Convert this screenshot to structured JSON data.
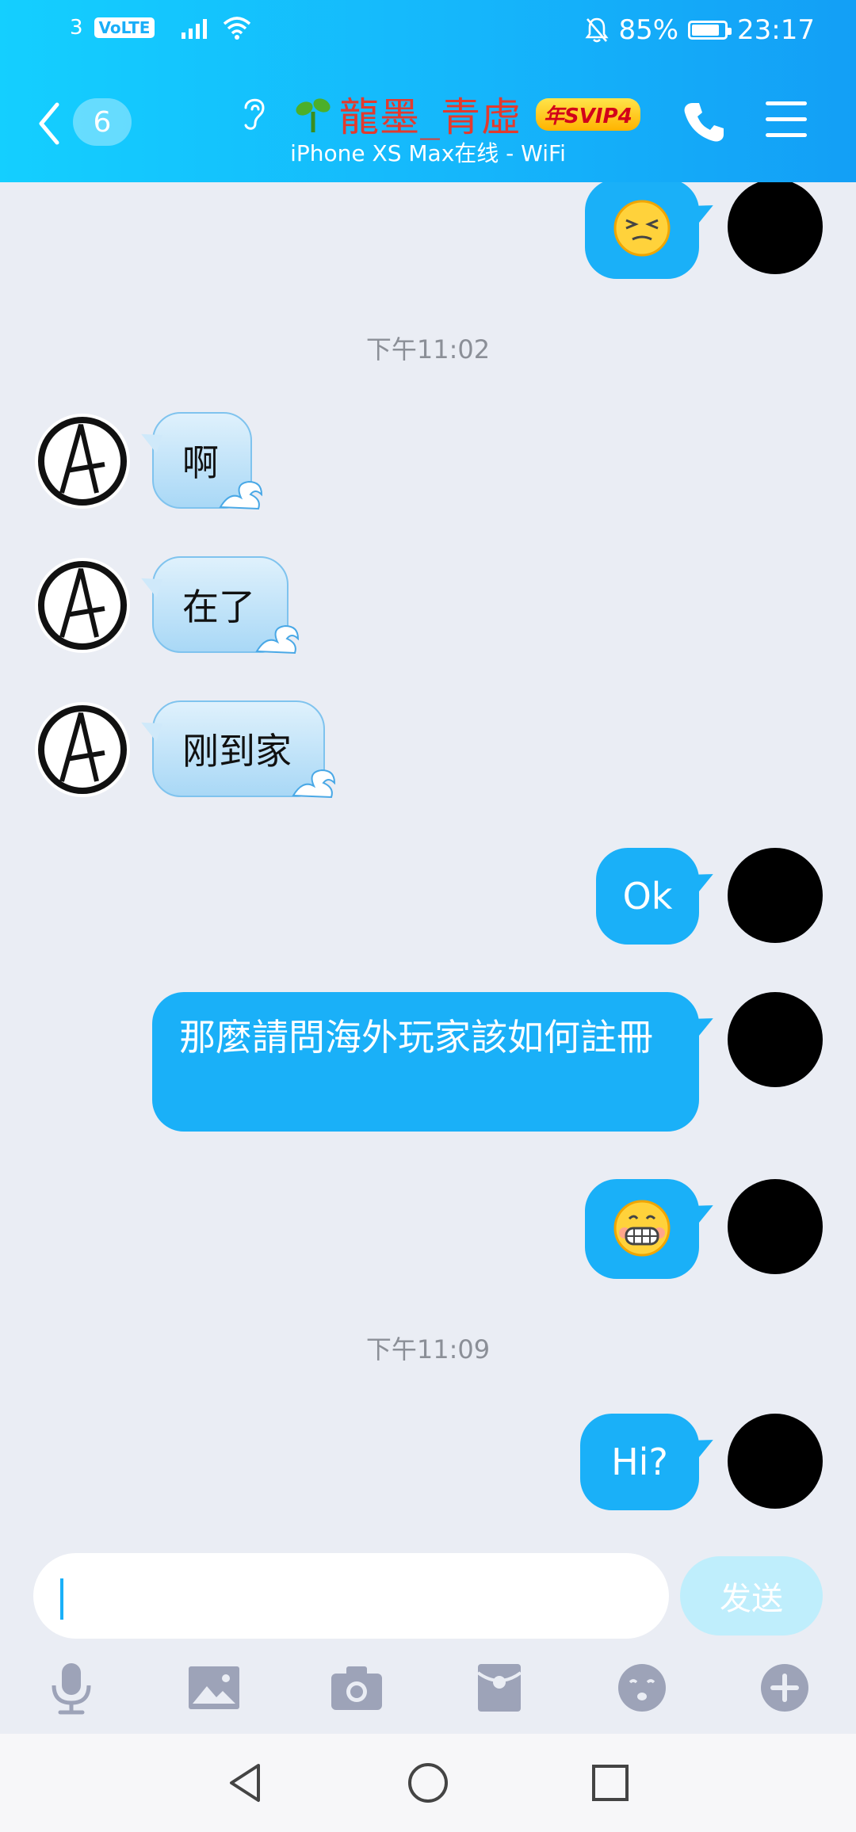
{
  "status_bar": {
    "sim": "3",
    "volte": "VoLTE",
    "battery_percent": "85%",
    "battery_level": 0.85,
    "time": "23:17"
  },
  "header": {
    "back_badge": "6",
    "contact_name": "龍墨_青虛",
    "vip_badge": "年SVIP4",
    "subtitle": "iPhone XS Max在线 - WiFi"
  },
  "chat": {
    "timestamps": [
      "下午11:02",
      "下午11:09"
    ],
    "incoming": [
      "啊",
      "在了",
      "刚到家"
    ],
    "outgoing": [
      "Ok",
      "那麼請問海外玩家該如何註冊",
      "Hi?"
    ]
  },
  "composer": {
    "input_value": "",
    "send_label": "发送"
  },
  "icons": {
    "toolbar": [
      "microphone-icon",
      "image-icon",
      "camera-icon",
      "red-envelope-icon",
      "emoji-icon",
      "plus-icon"
    ],
    "nav": [
      "back-triangle-icon",
      "home-circle-icon",
      "recents-square-icon"
    ]
  },
  "colors": {
    "header_gradient_start": "#14cfff",
    "header_gradient_end": "#139ff6",
    "outgoing_bubble": "#1ab0f8",
    "chat_background": "#eaedf4",
    "contact_name": "#e23a2e",
    "send_button": "#bfeefc",
    "toolbar_icon": "#9da3b8"
  }
}
